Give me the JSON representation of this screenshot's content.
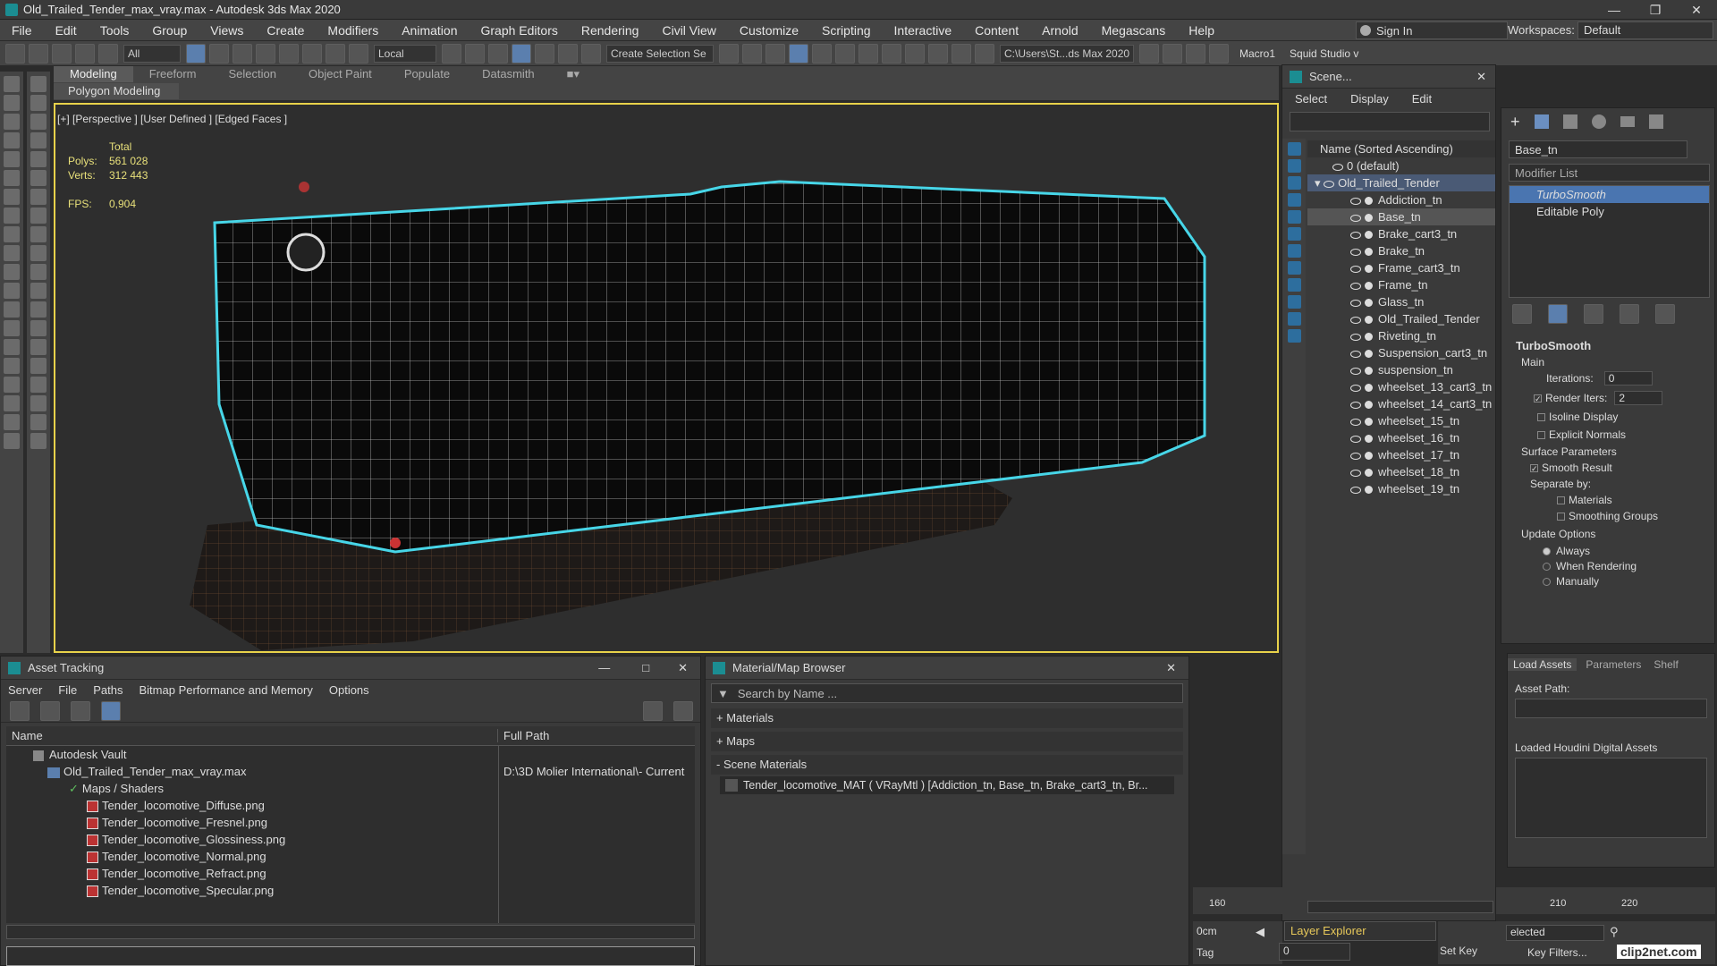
{
  "window": {
    "title": "Old_Trailed_Tender_max_vray.max - Autodesk 3ds Max 2020"
  },
  "menu": [
    "File",
    "Edit",
    "Tools",
    "Group",
    "Views",
    "Create",
    "Modifiers",
    "Animation",
    "Graph Editors",
    "Rendering",
    "Civil View",
    "Customize",
    "Scripting",
    "Interactive",
    "Content",
    "Arnold",
    "Megascans",
    "Help"
  ],
  "signin": {
    "label": "Sign In",
    "workspaces_label": "Workspaces:",
    "workspace": "Default"
  },
  "toolbar": {
    "filter": "All",
    "coord": "Local",
    "selection_set": "Create Selection Se",
    "path": "C:\\Users\\St...ds Max 2020",
    "macro": "Macro1",
    "squid": "Squid Studio v"
  },
  "ribbon": {
    "tabs": [
      "Modeling",
      "Freeform",
      "Selection",
      "Object Paint",
      "Populate",
      "Datasmith"
    ],
    "sub": "Polygon Modeling"
  },
  "viewport": {
    "label": "[+] [Perspective ] [User Defined ] [Edged Faces ]",
    "stats": {
      "total_label": "Total",
      "polys_label": "Polys:",
      "polys": "561 028",
      "verts_label": "Verts:",
      "verts": "312 443",
      "fps_label": "FPS:",
      "fps": "0,904"
    }
  },
  "scene_explorer": {
    "title": "Scene...",
    "menu": [
      "Select",
      "Display",
      "Edit"
    ],
    "header": "Name (Sorted Ascending)",
    "root": "0 (default)",
    "group": "Old_Trailed_Tender",
    "items": [
      "Addiction_tn",
      "Base_tn",
      "Brake_cart3_tn",
      "Brake_tn",
      "Frame_cart3_tn",
      "Frame_tn",
      "Glass_tn",
      "Old_Trailed_Tender",
      "Riveting_tn",
      "Suspension_cart3_tn",
      "suspension_tn",
      "wheelset_13_cart3_tn",
      "wheelset_14_cart3_tn",
      "wheelset_15_tn",
      "wheelset_16_tn",
      "wheelset_17_tn",
      "wheelset_18_tn",
      "wheelset_19_tn"
    ],
    "layer_label": "Layer Explorer"
  },
  "modify_panel": {
    "object_name": "Base_tn",
    "modifier_list": "Modifier List",
    "stack": [
      "TurboSmooth",
      "Editable Poly"
    ],
    "rollout": "TurboSmooth",
    "main": "Main",
    "iterations_label": "Iterations:",
    "iterations": "0",
    "render_iters_label": "Render Iters:",
    "render_iters": "2",
    "isoline": "Isoline Display",
    "explicit": "Explicit Normals",
    "surface": "Surface Parameters",
    "smooth": "Smooth Result",
    "separate": "Separate by:",
    "materials": "Materials",
    "smoothing": "Smoothing Groups",
    "update": "Update Options",
    "always": "Always",
    "when_rendering": "When Rendering",
    "manually": "Manually"
  },
  "houdini": {
    "tabs": [
      "Load Assets",
      "Parameters",
      "Shelf"
    ],
    "asset_path": "Asset Path:",
    "loaded": "Loaded Houdini Digital Assets"
  },
  "asset_tracking": {
    "title": "Asset Tracking",
    "menu": [
      "Server",
      "File",
      "Paths",
      "Bitmap Performance and Memory",
      "Options"
    ],
    "col_name": "Name",
    "col_path": "Full Path",
    "vault": "Autodesk Vault",
    "file": "Old_Trailed_Tender_max_vray.max",
    "file_path": "D:\\3D Molier International\\- Current",
    "maps": "Maps / Shaders",
    "textures": [
      "Tender_locomotive_Diffuse.png",
      "Tender_locomotive_Fresnel.png",
      "Tender_locomotive_Glossiness.png",
      "Tender_locomotive_Normal.png",
      "Tender_locomotive_Refract.png",
      "Tender_locomotive_Specular.png"
    ]
  },
  "material_browser": {
    "title": "Material/Map Browser",
    "search": "Search by Name ...",
    "sections": [
      "+ Materials",
      "+ Maps",
      "- Scene Materials"
    ],
    "scene_material": "Tender_locomotive_MAT  ( VRayMtl )  [Addiction_tn, Base_tn, Brake_cart3_tn, Br..."
  },
  "timeline": {
    "ticks": [
      "160",
      "210",
      "220"
    ],
    "cm": "0cm",
    "tag": "Tag",
    "frame": "0",
    "setkey": "Set Key",
    "keyfilters": "Key Filters...",
    "selected": "elected"
  },
  "watermark": "clip2net.com"
}
